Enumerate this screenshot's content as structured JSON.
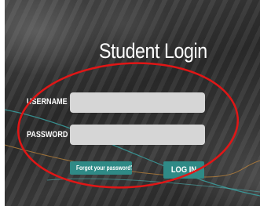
{
  "login_form": {
    "title": "Student Login",
    "username_label": "USERNAME",
    "username_value": "",
    "password_label": "PASSWORD",
    "password_value": "",
    "forgot_label": "Forgot your password?",
    "login_label": "LOG IN"
  },
  "colors": {
    "button_teal": "#2f8a86",
    "field_gray": "#d6d6d6",
    "highlight_ellipse": "#e01616",
    "background_dark": "#2f2f2f"
  }
}
